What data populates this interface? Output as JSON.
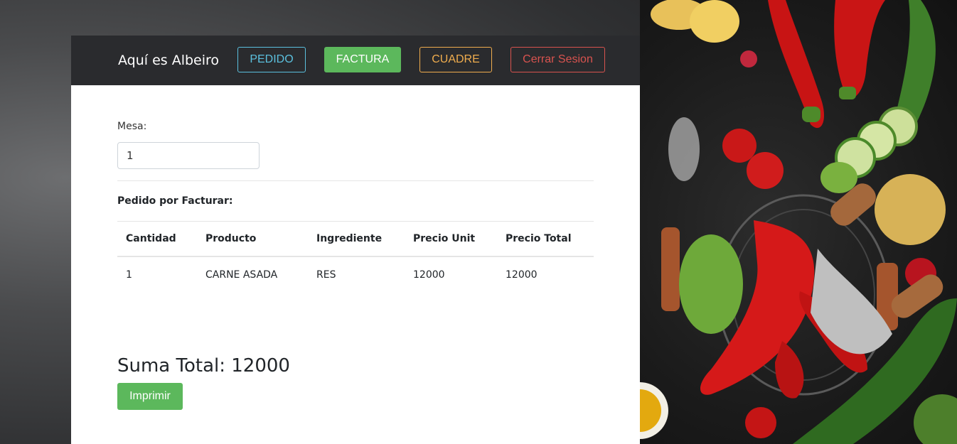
{
  "navbar": {
    "brand": "Aquí es Albeiro",
    "pedido": "PEDIDO",
    "factura": "FACTURA",
    "cuadre": "CUADRE",
    "cerrar": "Cerrar Sesion"
  },
  "form": {
    "mesa_label": "Mesa:",
    "mesa_value": "1"
  },
  "section_title": "Pedido por Facturar:",
  "table": {
    "headers": [
      "Cantidad",
      "Producto",
      "Ingrediente",
      "Precio Unit",
      "Precio Total"
    ],
    "rows": [
      [
        "1",
        "CARNE ASADA",
        "RES",
        "12000",
        "12000"
      ]
    ]
  },
  "total_label": "Suma Total: 12000",
  "print_button": "Imprimir",
  "colors": {
    "info": "#5bc0de",
    "success": "#5cb85c",
    "warning": "#f0ad4e",
    "danger": "#d9534f",
    "navbar": "#2a2b2e"
  }
}
